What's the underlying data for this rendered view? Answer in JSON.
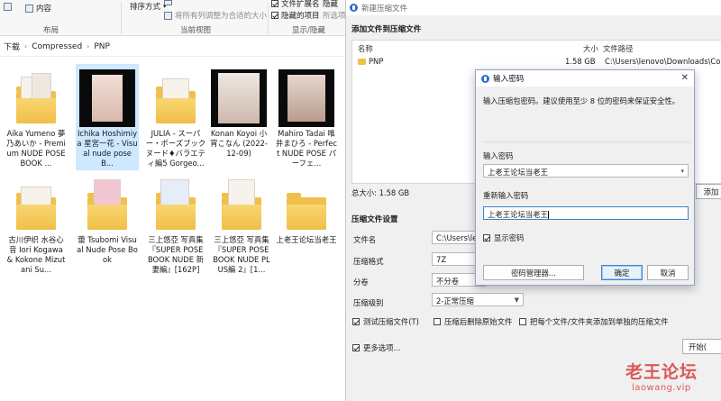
{
  "ribbon": {
    "sort_label": "排序方式",
    "fit_columns": "将所有列调整为合适的大小",
    "extensions_cb": "文件扩展名",
    "hidden_items_cb": "隐藏的项目",
    "hide_btn": "隐藏",
    "options_btn": "所选项",
    "content_label": "内容",
    "groups": [
      "布局",
      "当前视图",
      "显示/隐藏"
    ]
  },
  "breadcrumb": [
    "下载",
    "Compressed",
    "PNP"
  ],
  "files": [
    {
      "name": "Aika Yumeno 夢乃あいか - Premium NUDE POSE BOOK ...",
      "type": "folder",
      "selected": false
    },
    {
      "name": "Ichika Hoshimiya 星宮一花 - Visual nude pose B...",
      "type": "photo",
      "selected": true
    },
    {
      "name": "JULIA - スーパー・ポーズブック ヌード♦バラエティ編5 Gorgeo...",
      "type": "folder",
      "selected": false
    },
    {
      "name": "Konan Koyoi 小宵こなん (2022-12-09)",
      "type": "photo",
      "selected": false
    },
    {
      "name": "Mahiro Tadai 唯井まひろ - Perfect NUDE POSE パーフェ...",
      "type": "photo",
      "selected": false
    },
    {
      "name": "古川伊织 水谷心音 Iori Kogawa & Kokone Mizutani Su...",
      "type": "folder",
      "selected": false
    },
    {
      "name": "蕾 Tsubomi Visual Nude Pose Book",
      "type": "folder-pink",
      "selected": false
    },
    {
      "name": "三上悠亞 写真集『SUPER POSE BOOK NUDE 新妻編』[162P]",
      "type": "folder-blue",
      "selected": false
    },
    {
      "name": "三上悠亞 写真集『SUPER POSE BOOK NUDE PLUS編 2』[1...",
      "type": "folder",
      "selected": false
    },
    {
      "name": "上老王论坛当老王",
      "type": "folder-plain",
      "selected": false
    }
  ],
  "archive": {
    "title": "新建压缩文件",
    "add_section": "添加文件到压缩文件",
    "col_name": "名称",
    "col_size": "大小",
    "col_path": "文件路径",
    "row_name": "PNP",
    "row_size": "1.58 GB",
    "row_path": "C:\\Users\\lenovo\\Downloads\\Comp",
    "total_label": "总大小: 1.58 GB",
    "add_btn": "添加",
    "settings_section": "压缩文件设置",
    "filename_label": "文件名",
    "filename_value": "C:\\Users\\leno",
    "format_label": "压缩格式",
    "format_value": "7Z",
    "split_label": "分卷",
    "split_value": "不分卷",
    "level_label": "压缩级别",
    "level_value": "2-正常压缩",
    "test_cb": "测试压缩文件(T)",
    "delete_cb": "压缩后删除原始文件",
    "each_cb": "把每个文件/文件夹添加到单独的压缩文件",
    "more_cb": "更多选项...",
    "start_btn": "开始("
  },
  "password_dialog": {
    "title": "输入密码",
    "hint": "输入压缩包密码。建议使用至少 8 位的密码来保证安全性。",
    "enter_label": "输入密码",
    "enter_value": "上老王论坛当老王",
    "reenter_label": "重新输入密码",
    "reenter_value": "上老王论坛当老王",
    "show_cb": "显示密码",
    "manager_btn": "密码管理器...",
    "ok_btn": "确定",
    "cancel_btn": "取消"
  },
  "watermark": {
    "cn": "老王论坛",
    "url": "laowang.vip"
  }
}
